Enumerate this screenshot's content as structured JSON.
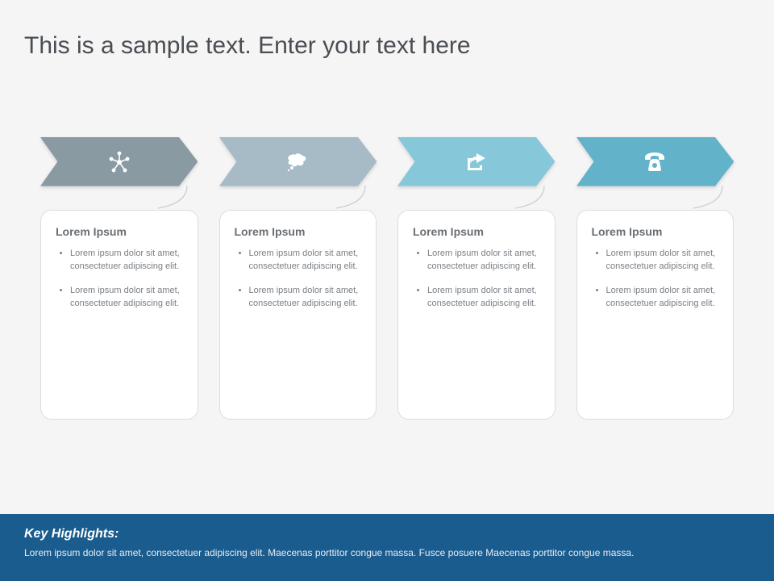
{
  "title": "This is a sample text. Enter your text here",
  "steps": [
    {
      "icon": "network-icon",
      "color": "#8a9aa3",
      "card_title": "Lorem Ipsum",
      "bullets": [
        "Lorem ipsum dolor sit amet, consectetuer adipiscing elit.",
        "Lorem ipsum dolor sit amet, consectetuer adipiscing elit."
      ]
    },
    {
      "icon": "thought-icon",
      "color": "#a7bbc6",
      "card_title": "Lorem Ipsum",
      "bullets": [
        "Lorem ipsum dolor sit amet, consectetuer adipiscing elit.",
        "Lorem ipsum dolor sit amet, consectetuer adipiscing elit."
      ]
    },
    {
      "icon": "share-icon",
      "color": "#86c8d9",
      "card_title": "Lorem Ipsum",
      "bullets": [
        "Lorem ipsum dolor sit amet, consectetuer adipiscing elit.",
        "Lorem ipsum dolor sit amet, consectetuer adipiscing elit."
      ]
    },
    {
      "icon": "phone-icon",
      "color": "#62b3c9",
      "card_title": "Lorem Ipsum",
      "bullets": [
        "Lorem ipsum dolor sit amet, consectetuer adipiscing elit.",
        "Lorem ipsum dolor sit amet, consectetuer adipiscing elit."
      ]
    }
  ],
  "footer": {
    "title": "Key Highlights:",
    "body": "Lorem ipsum dolor sit amet, consectetuer adipiscing elit. Maecenas porttitor congue massa. Fusce posuere Maecenas porttitor congue massa."
  }
}
